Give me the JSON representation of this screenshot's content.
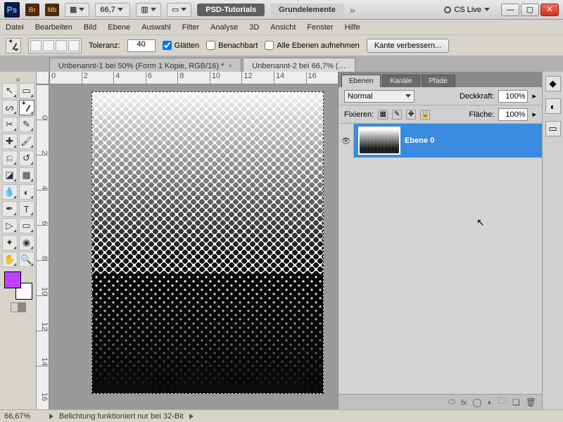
{
  "titlebar": {
    "zoom_preset": "66,7",
    "workspace_dark": "PSD-Tutorials",
    "workspace_light": "Grundelemente",
    "cs_live": "CS Live"
  },
  "menu": {
    "items": [
      "Datei",
      "Bearbeiten",
      "Bild",
      "Ebene",
      "Auswahl",
      "Filter",
      "Analyse",
      "3D",
      "Ansicht",
      "Fenster",
      "Hilfe"
    ]
  },
  "options": {
    "tolerance_label": "Toleranz:",
    "tolerance_value": "40",
    "smooth": "Glätten",
    "contiguous": "Benachbart",
    "all_layers": "Alle Ebenen aufnehmen",
    "refine_edge": "Kante verbessern..."
  },
  "doctabs": [
    {
      "label": "Unbenannt-1 bei 50% (Form 1 Kopie, RGB/16) *"
    },
    {
      "label": "Unbenannt-2 bei 66,7% (…"
    }
  ],
  "ruler_h": [
    "0",
    "2",
    "4",
    "6",
    "8",
    "10",
    "12",
    "14",
    "16"
  ],
  "ruler_v": [
    "0",
    "2",
    "4",
    "6",
    "8",
    "10",
    "12",
    "14",
    "16"
  ],
  "layers_panel": {
    "tabs": [
      "Ebenen",
      "Kanäle",
      "Pfade"
    ],
    "blend_mode": "Normal",
    "opacity_label": "Deckkraft:",
    "opacity_value": "100%",
    "lock_label": "Fixieren:",
    "fill_label": "Fläche:",
    "fill_value": "100%",
    "layers": [
      {
        "name": "Ebene 0",
        "visible": true,
        "selected": true
      }
    ]
  },
  "status": {
    "zoom": "66,67%",
    "message": "Belichtung funktioniert nur bei 32-Bit"
  },
  "colors": {
    "foreground": "#c040ff",
    "background": "#ffffff",
    "selection_blue": "#3b8be0"
  }
}
